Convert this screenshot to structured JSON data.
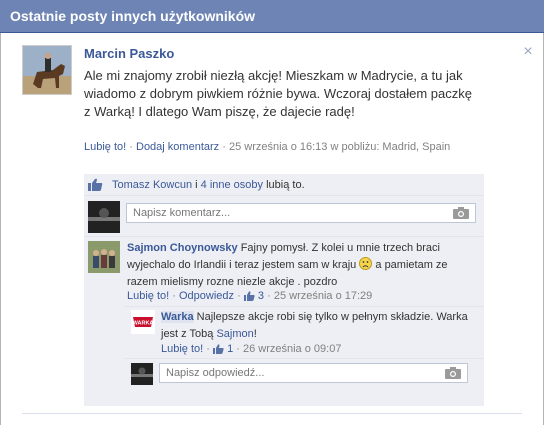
{
  "header": {
    "title": "Ostatnie posty innych użytkowników"
  },
  "post": {
    "author": "Marcin Paszko",
    "text": "Ale mi znajomy zrobił niezłą akcję! Mieszkam w Madrycie, a tu jak wiadomo z dobrym piwkiem różnie bywa. Wczoraj dostałem paczkę z Warką! I dlatego Wam piszę, że dajecie radę!",
    "like_label": "Lubię to!",
    "comment_label": "Dodaj komentarz",
    "meta_rest": "25 września o 16:13 w pobliżu: Madrid, Spain"
  },
  "likes": {
    "person": "Tomasz Kowcun",
    "conj": " i ",
    "others": "4 inne osoby",
    "suffix": " lubią to."
  },
  "comment_input": {
    "placeholder": "Napisz komentarz..."
  },
  "comment1": {
    "author": "Sajmon Choynowsky",
    "text_a": "Fajny pomysł. Z kolei u mnie trzech braci wyjechalo do Irlandii i teraz jestem sam w kraju",
    "text_b": "a pamietam ze razem mielismy rozne niezle akcje . pozdro",
    "like_label": "Lubię to!",
    "reply_label": "Odpowiedz",
    "like_count": "3",
    "time": "25 września o 17:29"
  },
  "reply1": {
    "author": "Warka",
    "text_a": "Najlepsze akcje robi się tylko w pełnym składzie. Warka jest z Tobą",
    "mention": "Sajmon",
    "text_end": "!",
    "like_label": "Lubię to!",
    "like_count": "1",
    "time": "26 września o 09:07",
    "logo_text": "WARKA"
  },
  "reply_input": {
    "placeholder": "Napisz odpowiedź..."
  },
  "icons": {
    "close": "close-icon",
    "thumb": "thumbs-up-icon",
    "camera": "camera-icon",
    "smiley": "sad-smiley-icon"
  },
  "colors": {
    "header_bg": "#6d84b4",
    "link": "#3b5998",
    "ufi_bg": "#edeff4"
  }
}
